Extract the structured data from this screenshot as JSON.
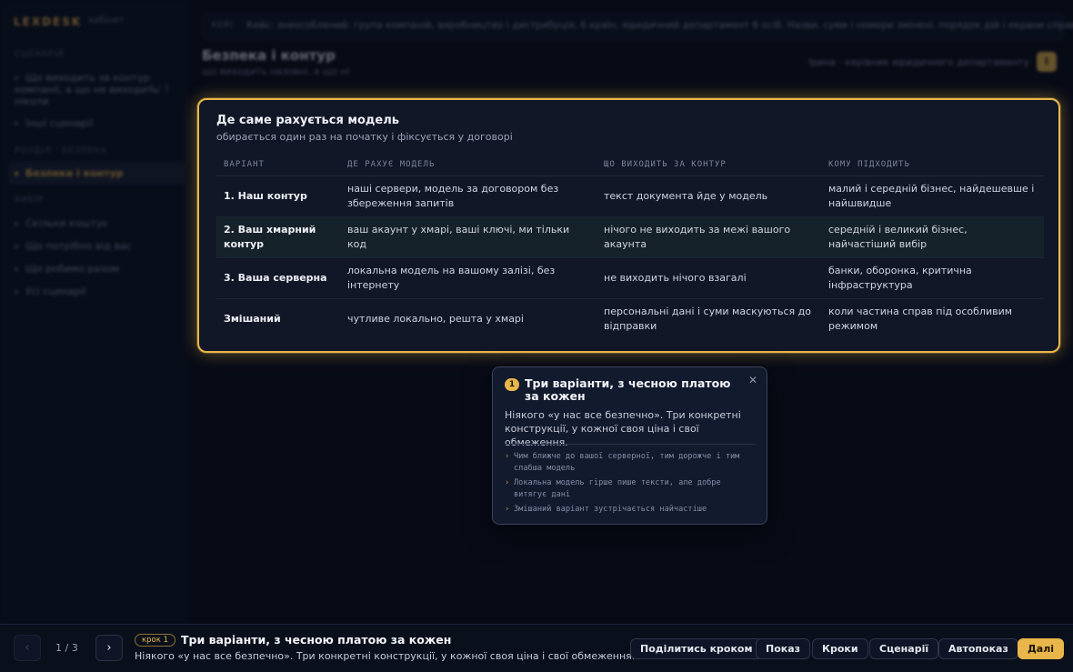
{
  "app": {
    "brand": "LEXDESK",
    "brand_sub": "кабінет",
    "role_text": "Ірина · керівник юридичного департаменту",
    "role_badge": "І"
  },
  "sidebar": {
    "section1": "Сценарій",
    "scenario": "Що виходить за контур компанії, а що не виходить ніколи",
    "scenario_count": "1 / 3",
    "other": "Інші сценарії",
    "section2": "Розділ · Безпека",
    "active": "Безпека і контур",
    "section3": "Вибір",
    "items": [
      "Скільки коштує",
      "Що потрібно від вас",
      "Що робимо разом",
      "Усі сценарії"
    ]
  },
  "topbar": {
    "tag": "КЕЙС",
    "text": "Кейс: знеособлений: група компаній, виробництво і дистрибуція, 6 країн, юридичний департамент 6 осіб. Назви, суми і номери змінені, порядок дій і екрани справжні."
  },
  "page": {
    "title": "Безпека і контур",
    "subtitle": "що виходить назовні, а що ні"
  },
  "card": {
    "title": "Де саме рахується модель",
    "subtitle": "обирається один раз на початку і фіксується у договорі",
    "headers": [
      "Варіант",
      "Де рахує модель",
      "Що виходить за контур",
      "Кому підходить"
    ],
    "rows": [
      [
        "1. Наш контур",
        "наші сервери, модель за договором без збереження запитів",
        "текст документа йде у модель",
        "малий і середній бізнес, найдешевше і найшвидше"
      ],
      [
        "2. Ваш хмарний контур",
        "ваш акаунт у хмарі, ваші ключі, ми тільки код",
        "нічого не виходить за межі вашого акаунта",
        "середній і великий бізнес, найчастіший вибір"
      ],
      [
        "3. Ваша серверна",
        "локальна модель на вашому залізі, без інтернету",
        "не виходить нічого взагалі",
        "банки, оборонка, критична інфраструктура"
      ],
      [
        "Змішаний",
        "чутливе локально, решта у хмарі",
        "персональні дані і суми маскуються до відправки",
        "коли частина справ під особливим режимом"
      ]
    ]
  },
  "tooltip": {
    "num": "1",
    "title": "Три варіанти, з чесною платою за кожен",
    "body": "Ніякого «у нас все безпечно». Три конкретні конструкції, у кожної своя ціна і свої обмеження.",
    "close": "✕",
    "bullets": [
      "Чим ближче до вашої серверної, тим дорожче і тим слабша модель",
      "Локальна модель гірше пише тексти, але добре витягує дані",
      "Змішаний варіант зустрічається найчастіше"
    ]
  },
  "bottom": {
    "prev": "‹",
    "next": "›",
    "pager": "1 / 3",
    "step_badge": "крок 1",
    "step_title": "Три варіанти, з чесною платою за кожен",
    "step_desc": "Ніякого «у нас все безпечно». Три конкретні конструкції, у кожної своя ціна і свої обмеження.",
    "buttons": {
      "share": "Поділитись кроком",
      "show": "Показ",
      "steps": "Кроки",
      "scenarios": "Сценарії",
      "autoplay": "Автопоказ",
      "next": "Далі"
    }
  },
  "colors": {
    "accent": "#e8b64a",
    "background": "#070b16"
  }
}
